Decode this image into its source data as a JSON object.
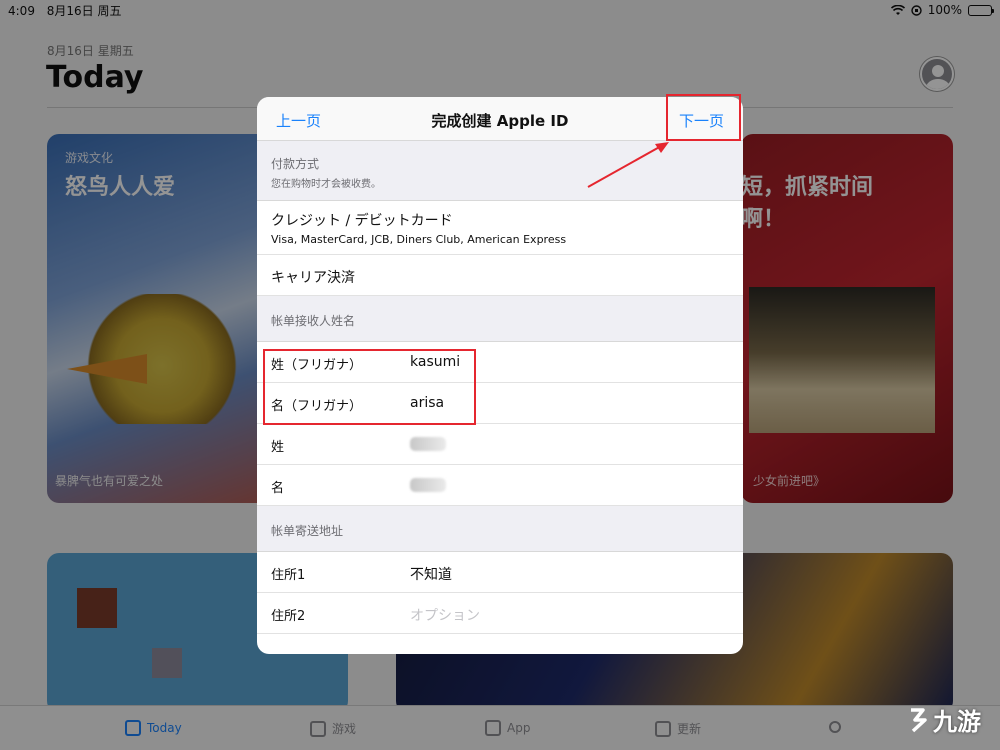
{
  "status_bar": {
    "time": "4:09",
    "date": "8月16日 周五",
    "battery": "100%"
  },
  "background": {
    "date": "8月16日 星期五",
    "title": "Today",
    "cards": [
      {
        "tag": "游戏文化",
        "title": "怒鸟人人爱",
        "footer": "暴脾气也有可爱之处"
      },
      {
        "title_line1": "短，抓紧时间",
        "title_line2": "啊！",
        "footer": "少女前进吧》"
      }
    ],
    "tabs": [
      {
        "label": "Today",
        "icon": "today-icon"
      },
      {
        "label": "游戏",
        "icon": "rocket-icon"
      },
      {
        "label": "App",
        "icon": "layers-icon"
      },
      {
        "label": "更新",
        "icon": "download-icon"
      }
    ]
  },
  "dialog": {
    "back_label": "上一页",
    "title": "完成创建 Apple ID",
    "next_label": "下一页",
    "payment": {
      "header": "付款方式",
      "subheader": "您在购物时才会被收费。",
      "options": [
        {
          "label": "クレジット / デビットカード",
          "sub": "Visa, MasterCard, JCB, Diners Club, American Express"
        },
        {
          "label": "キャリア決済"
        }
      ]
    },
    "billing_name": {
      "header": "帐单接收人姓名",
      "fields": [
        {
          "label": "姓（フリガナ）",
          "value": "kasumi"
        },
        {
          "label": "名（フリガナ）",
          "value": "arisa"
        },
        {
          "label": "姓",
          "value": ""
        },
        {
          "label": "名",
          "value": ""
        }
      ]
    },
    "billing_address": {
      "header": "帐单寄送地址",
      "fields": [
        {
          "label": "住所1",
          "value": "不知道"
        },
        {
          "label": "住所2",
          "placeholder": "オプション"
        }
      ]
    }
  },
  "watermark": {
    "text": "九游"
  },
  "colors": {
    "accent": "#1a82fb",
    "annotation": "#e5262f",
    "group_bg": "#efeff4"
  }
}
